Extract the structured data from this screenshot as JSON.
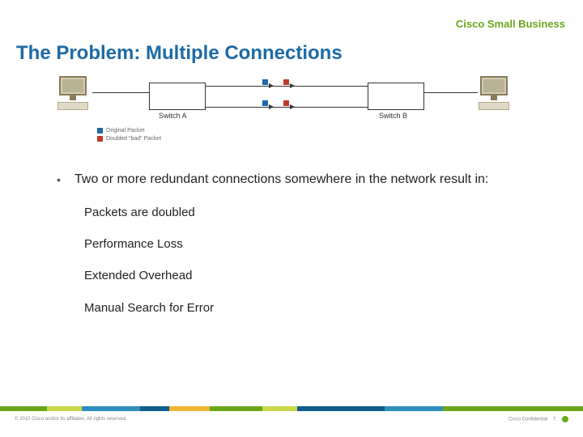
{
  "header": {
    "brand": "Cisco Small Business"
  },
  "title": "The Problem: Multiple Connections",
  "diagram": {
    "switch_a_label": "Switch A",
    "switch_b_label": "Switch B",
    "legend": {
      "original": "Original Packet",
      "doubled": "Doubled \"bad\" Packet"
    }
  },
  "bullets": {
    "main": "Two or more redundant connections somewhere in the network result in:",
    "subs": [
      "Packets are doubled",
      "Performance Loss",
      "Extended Overhead",
      "Manual Search for Error"
    ]
  },
  "footer": {
    "copyright": "© 2010 Cisco and/or its affiliates. All rights reserved.",
    "confidential": "Cisco Confidential",
    "page": "7"
  }
}
